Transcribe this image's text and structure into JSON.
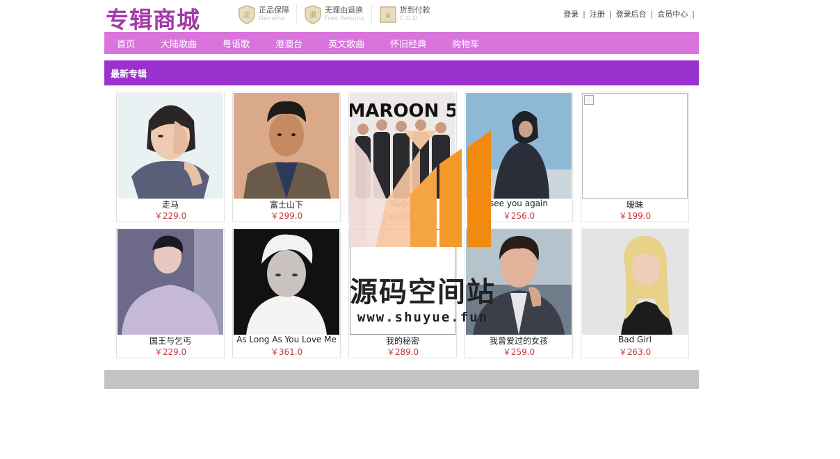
{
  "header": {
    "logo": "专辑商城",
    "badges": [
      {
        "title": "正品保障",
        "sub": "Genuine",
        "icon": "genuine-shield-icon"
      },
      {
        "title": "无理由退换",
        "sub": "Free Returns",
        "icon": "returns-shield-icon"
      },
      {
        "title": "货到付款",
        "sub": "C.O.D",
        "icon": "cod-icon"
      }
    ],
    "links": [
      "登录",
      "注册",
      "登录后台",
      "会员中心"
    ]
  },
  "nav": [
    "首页",
    "大陆歌曲",
    "粤语歌",
    "港澳台",
    "英文歌曲",
    "怀旧经典",
    "购物车"
  ],
  "section": {
    "title": "最新专辑"
  },
  "albums": [
    {
      "name": "走马",
      "price": "￥229.0"
    },
    {
      "name": "富士山下",
      "price": "￥299.0"
    },
    {
      "name": "Sugar",
      "price": "￥229.0"
    },
    {
      "name": "see you again",
      "price": "￥256.0"
    },
    {
      "name": "暧昧",
      "price": "￥199.0"
    },
    {
      "name": "国王与乞丐",
      "price": "￥229.0"
    },
    {
      "name": "As Long As You Love Me",
      "price": "￥361.0"
    },
    {
      "name": "我的秘密",
      "price": "￥289.0"
    },
    {
      "name": "我曾爱过的女孩",
      "price": "￥259.0"
    },
    {
      "name": "Bad Girl",
      "price": "￥263.0"
    }
  ],
  "maroon5_text": "MAROON 5",
  "watermark": {
    "title": "源码空间站",
    "url": "www.shuyue.fun"
  },
  "colors": {
    "logo": "#a33aa8",
    "nav": "#d874dc",
    "section": "#9b32cf",
    "price": "#c0383a",
    "footer": "#c4c4c4"
  }
}
